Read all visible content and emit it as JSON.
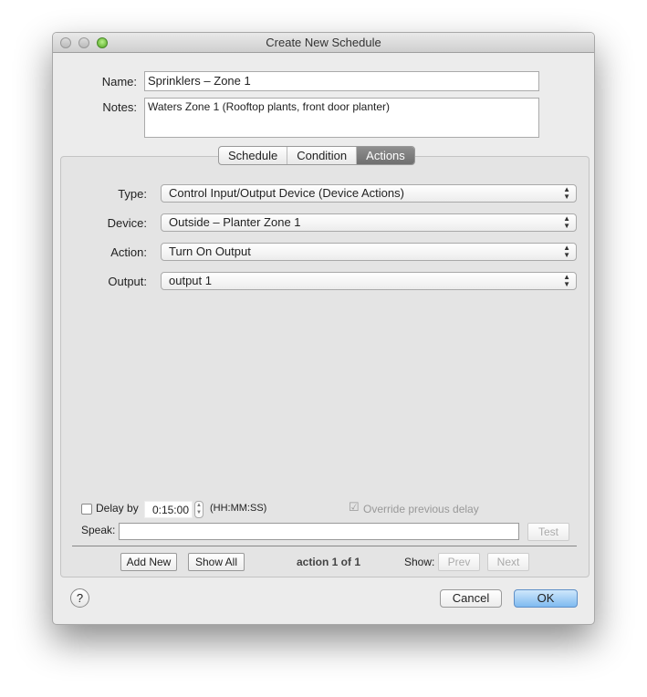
{
  "window": {
    "title": "Create New Schedule"
  },
  "form": {
    "name_label": "Name:",
    "name_value": "Sprinklers – Zone 1",
    "notes_label": "Notes:",
    "notes_value": "Waters Zone 1 (Rooftop plants, front door planter)"
  },
  "tabs": [
    {
      "label": "Schedule",
      "selected": false
    },
    {
      "label": "Condition",
      "selected": false
    },
    {
      "label": "Actions",
      "selected": true
    }
  ],
  "actions": {
    "fields": [
      {
        "label": "Type:",
        "value": "Control Input/Output Device (Device Actions)"
      },
      {
        "label": "Device:",
        "value": "Outside – Planter Zone 1"
      },
      {
        "label": "Action:",
        "value": "Turn On Output"
      },
      {
        "label": "Output:",
        "value": "output 1"
      }
    ],
    "delay_label": "Delay by",
    "delay_checked": false,
    "delay_value": "0:15:00",
    "delay_format": "(HH:MM:SS)",
    "override_label": "Override previous delay",
    "override_checked": true,
    "speak_label": "Speak:",
    "speak_value": "",
    "test_label": "Test",
    "add_new_label": "Add New",
    "show_all_label": "Show All",
    "counter": "action 1 of 1",
    "show_label": "Show:",
    "prev_label": "Prev",
    "next_label": "Next"
  },
  "footer": {
    "help_label": "?",
    "cancel_label": "Cancel",
    "ok_label": "OK"
  }
}
